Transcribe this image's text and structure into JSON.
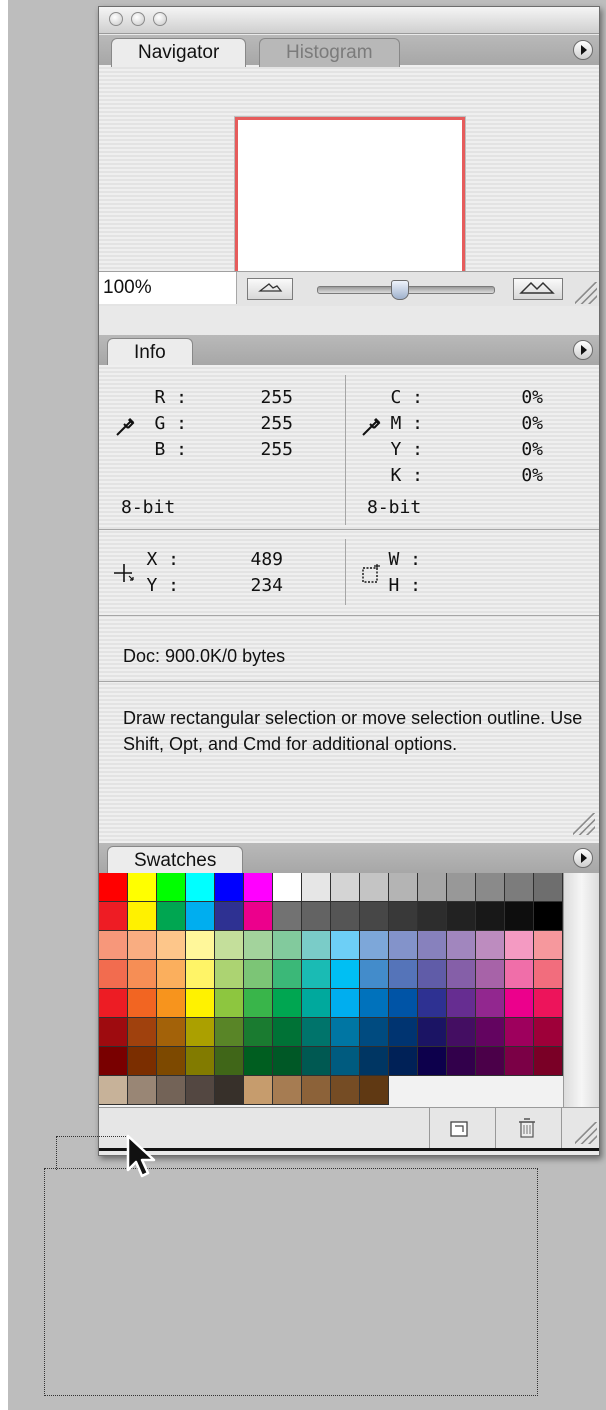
{
  "window": {
    "controls": [
      "close",
      "minimize",
      "zoom"
    ]
  },
  "navigator": {
    "tabs": [
      {
        "label": "Navigator",
        "active": true
      },
      {
        "label": "Histogram",
        "active": false
      }
    ],
    "zoom_value": "100%",
    "preview_border_color": "#e65c5c"
  },
  "info": {
    "tab_label": "Info",
    "rgb": {
      "labels": [
        "R :",
        "G :",
        "B :"
      ],
      "values": [
        "255",
        "255",
        "255"
      ],
      "bit_depth": "8-bit"
    },
    "cmyk": {
      "labels": [
        "C :",
        "M :",
        "Y :",
        "K :"
      ],
      "values": [
        "0%",
        "0%",
        "0%",
        "0%"
      ],
      "bit_depth": "8-bit"
    },
    "xy": {
      "labels": [
        "X :",
        "Y :"
      ],
      "values": [
        "489",
        "234"
      ]
    },
    "wh": {
      "labels": [
        "W :",
        "H :"
      ]
    },
    "doc_size": "Doc: 900.0K/0 bytes",
    "hint": "Draw rectangular selection or move selection outline.  Use Shift, Opt, and Cmd for additional options."
  },
  "swatches": {
    "tab_label": "Swatches",
    "rows": [
      [
        "#ff0000",
        "#ffff00",
        "#00ff00",
        "#00ffff",
        "#0000ff",
        "#ff00ff",
        "#ffffff",
        "#e6e6e6",
        "#d4d4d4",
        "#c4c4c4",
        "#b4b4b4",
        "#a6a6a6",
        "#989898",
        "#8a8a8a",
        "#7c7c7c",
        "#6e6e6e"
      ],
      [
        "#ee1c24",
        "#fff100",
        "#00a651",
        "#00aeef",
        "#2e3192",
        "#ec008c",
        "#727272",
        "#636363",
        "#555555",
        "#474747",
        "#393939",
        "#2d2d2d",
        "#222222",
        "#181818",
        "#0e0e0e",
        "#000000"
      ],
      [
        "#f7977a",
        "#f9ad81",
        "#fdc68a",
        "#fff79a",
        "#c4df9b",
        "#a3d39c",
        "#82ca9d",
        "#7accc8",
        "#6dcff6",
        "#7da7d9",
        "#8393ca",
        "#8781bd",
        "#a186be",
        "#bd8cbf",
        "#f49ac2",
        "#f6989d"
      ],
      [
        "#f26c4f",
        "#f68e55",
        "#fbaf5d",
        "#fff467",
        "#acd372",
        "#7cc576",
        "#3bb878",
        "#1abbb4",
        "#00bff3",
        "#438ccb",
        "#5574b9",
        "#605ca8",
        "#855fa8",
        "#a763a8",
        "#f06ea9",
        "#f26d7d"
      ],
      [
        "#ed1c24",
        "#f26522",
        "#f7941d",
        "#fff200",
        "#8dc63f",
        "#39b54a",
        "#00a651",
        "#00a99d",
        "#00aeef",
        "#0072bc",
        "#0054a6",
        "#2e3192",
        "#662d91",
        "#92278f",
        "#ec008c",
        "#ed145b"
      ],
      [
        "#9e0b0f",
        "#a0410d",
        "#a36209",
        "#aba000",
        "#598527",
        "#1a7b30",
        "#007236",
        "#00746b",
        "#0076a3",
        "#004b80",
        "#003471",
        "#1b1464",
        "#440e62",
        "#630460",
        "#9e005d",
        "#9e0039"
      ],
      [
        "#790000",
        "#7b2e00",
        "#7d4900",
        "#827b00",
        "#406618",
        "#005e20",
        "#005826",
        "#005952",
        "#005b7f",
        "#003663",
        "#002157",
        "#0d004c",
        "#32004b",
        "#4b0049",
        "#7b0046",
        "#7a0026"
      ],
      [
        "#c7b299",
        "#998675",
        "#736357",
        "#534741",
        "#37302a",
        "#c69c6d",
        "#a67c52",
        "#8c6239",
        "#754c24",
        "#603913"
      ]
    ]
  }
}
